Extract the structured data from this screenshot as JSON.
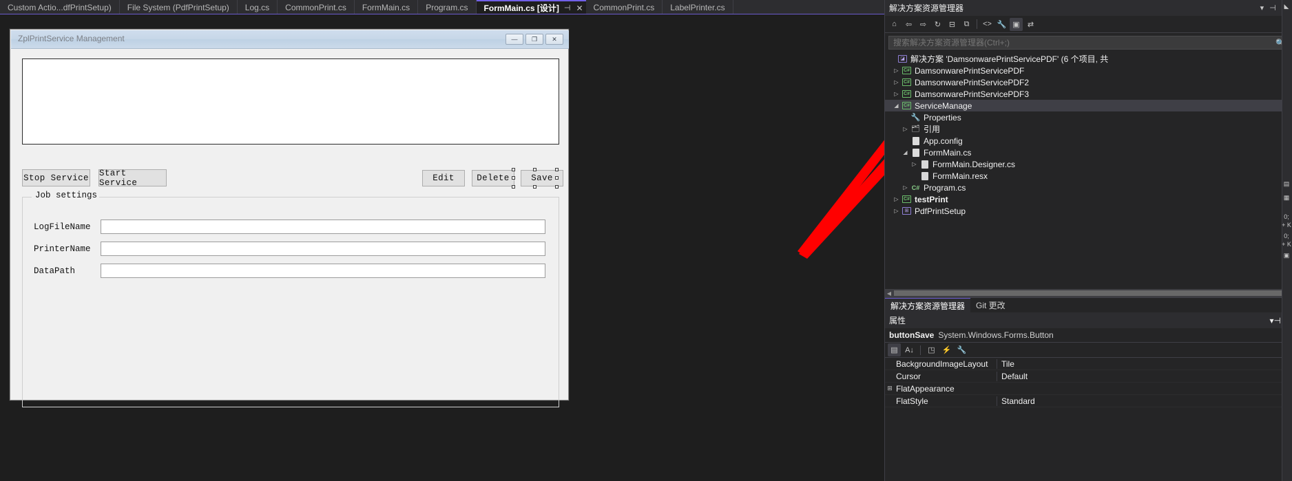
{
  "tabbar": {
    "tabs": [
      {
        "label": "Custom Actio...dfPrintSetup)",
        "active": false
      },
      {
        "label": "File System (PdfPrintSetup)",
        "active": false
      },
      {
        "label": "Log.cs",
        "active": false
      },
      {
        "label": "CommonPrint.cs",
        "active": false
      },
      {
        "label": "FormMain.cs",
        "active": false
      },
      {
        "label": "Program.cs",
        "active": false
      },
      {
        "label": "FormMain.cs [设计]",
        "active": true
      },
      {
        "label": "CommonPrint.cs",
        "active": false
      },
      {
        "label": "LabelPrinter.cs",
        "active": false
      }
    ],
    "active_pin_icon": "⊣",
    "active_close_icon": "✕",
    "overflow_icon": "▼",
    "settings_icon": "⚙"
  },
  "designer": {
    "form": {
      "title": "ZplPrintService Management",
      "minimize_label": "—",
      "maximize_label": "❐",
      "close_label": "✕",
      "log_textbox_value": "",
      "buttons_left": [
        {
          "label": "Stop Service"
        },
        {
          "label": "Start Service"
        }
      ],
      "buttons_right": [
        {
          "label": "Edit",
          "selected": false
        },
        {
          "label": "Delete",
          "selected": false
        },
        {
          "label": "Save",
          "selected": true
        }
      ],
      "groupbox_label": "Job settings",
      "fields": [
        {
          "label": "LogFileName",
          "value": ""
        },
        {
          "label": "PrinterName",
          "value": ""
        },
        {
          "label": "DataPath",
          "value": ""
        }
      ]
    }
  },
  "solution_explorer": {
    "title": "解决方案资源管理器",
    "header_icons": [
      "chevron-down-icon",
      "pin-icon",
      "close-icon"
    ],
    "toolbar_icons": [
      "home-icon",
      "back-icon",
      "forward-icon",
      "refresh-icon",
      "collapse-all-icon",
      "show-all-files-icon",
      "code-view-icon",
      "properties-icon",
      "preview-icon",
      "sync-icon"
    ],
    "search_placeholder": "搜索解决方案资源管理器(Ctrl+;)",
    "search_value": "",
    "search_icon": "🔍",
    "tree": [
      {
        "label": "解决方案 'DamsonwarePrintServicePDF' (6 个项目, 共",
        "depth": 0,
        "icon": "solution-icon",
        "arrow": "",
        "selected": false,
        "bold": false
      },
      {
        "label": "DamsonwarePrintServicePDF",
        "depth": 1,
        "icon": "csproj-icon",
        "arrow": "▷",
        "selected": false,
        "bold": false
      },
      {
        "label": "DamsonwarePrintServicePDF2",
        "depth": 1,
        "icon": "csproj-icon",
        "arrow": "▷",
        "selected": false,
        "bold": false
      },
      {
        "label": "DamsonwarePrintServicePDF3",
        "depth": 1,
        "icon": "csproj-icon",
        "arrow": "▷",
        "selected": false,
        "bold": false
      },
      {
        "label": "ServiceManage",
        "depth": 1,
        "icon": "csproj-icon",
        "arrow": "◢",
        "selected": true,
        "bold": false
      },
      {
        "label": "Properties",
        "depth": 2,
        "icon": "wrench-icon",
        "arrow": "",
        "selected": false,
        "bold": false
      },
      {
        "label": "引用",
        "depth": 2,
        "icon": "references-icon",
        "arrow": "▷",
        "selected": false,
        "bold": false
      },
      {
        "label": "App.config",
        "depth": 2,
        "icon": "config-file-icon",
        "arrow": "",
        "selected": false,
        "bold": false
      },
      {
        "label": "FormMain.cs",
        "depth": 2,
        "icon": "form-file-icon",
        "arrow": "◢",
        "selected": false,
        "bold": false
      },
      {
        "label": "FormMain.Designer.cs",
        "depth": 3,
        "icon": "file-icon",
        "arrow": "▷",
        "selected": false,
        "bold": false
      },
      {
        "label": "FormMain.resx",
        "depth": 3,
        "icon": "file-icon",
        "arrow": "",
        "selected": false,
        "bold": false
      },
      {
        "label": "Program.cs",
        "depth": 2,
        "icon": "csharp-file-icon",
        "arrow": "▷",
        "selected": false,
        "bold": false
      },
      {
        "label": "testPrint",
        "depth": 1,
        "icon": "csproj-icon",
        "arrow": "▷",
        "selected": false,
        "bold": true
      },
      {
        "label": "PdfPrintSetup",
        "depth": 1,
        "icon": "setup-project-icon",
        "arrow": "▷",
        "selected": false,
        "bold": false
      }
    ],
    "hscroll_left_icon": "◀",
    "hscroll_right_icon": "▶",
    "bottom_tabs": [
      {
        "label": "解决方案资源管理器",
        "active": true
      },
      {
        "label": "Git 更改",
        "active": false
      }
    ]
  },
  "properties": {
    "title": "属性",
    "header_icons": [
      "chevron-down-icon",
      "pin-icon",
      "close-icon"
    ],
    "object_name": "buttonSave",
    "object_type": "System.Windows.Forms.Button",
    "toolbar_icons": [
      "categorized-icon",
      "alphabetical-icon",
      "properties-icon",
      "events-icon",
      "property-pages-icon"
    ],
    "rows": [
      {
        "name": "BackgroundImageLayout",
        "value": "Tile",
        "expander": ""
      },
      {
        "name": "Cursor",
        "value": "Default",
        "expander": ""
      },
      {
        "name": "FlatAppearance",
        "value": "",
        "expander": "⊞"
      },
      {
        "name": "FlatStyle",
        "value": "Standard",
        "expander": ""
      }
    ]
  },
  "colors": {
    "accent": "#6a5acd",
    "arrow": "#ff0000",
    "panel_bg": "#252526",
    "chrome_bg": "#2d2d30",
    "editor_bg": "#1e1e1e"
  }
}
